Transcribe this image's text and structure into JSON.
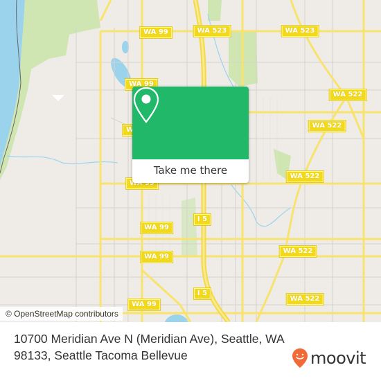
{
  "map": {
    "attribution": "© OpenStreetMap contributors",
    "colors": {
      "background": "#efece8",
      "water": "#9cd3ec",
      "park": "#cfe6b2",
      "road_major": "#f7e36d",
      "road_minor": "#d8d4cf",
      "popup_green": "#21b86a",
      "moovit_orange": "#f26a36"
    },
    "road_labels": [
      {
        "name": "WA 99"
      },
      {
        "name": "WA 523"
      },
      {
        "name": "WA 523"
      },
      {
        "name": "WA 99"
      },
      {
        "name": "WA 522"
      },
      {
        "name": "WA 99"
      },
      {
        "name": "WA 522"
      },
      {
        "name": "WA 99"
      },
      {
        "name": "WA 522"
      },
      {
        "name": "WA 99"
      },
      {
        "name": "I 5"
      },
      {
        "name": "WA 522"
      },
      {
        "name": "WA 99"
      },
      {
        "name": "I 5"
      },
      {
        "name": "WA 522"
      },
      {
        "name": "WA 99"
      }
    ]
  },
  "popup": {
    "icon": "location-pin-icon",
    "button_label": "Take me there"
  },
  "footer": {
    "address": "10700 Meridian Ave N (Meridian Ave), Seattle, WA 98133, Seattle Tacoma Bellevue",
    "brand": "moovit"
  }
}
